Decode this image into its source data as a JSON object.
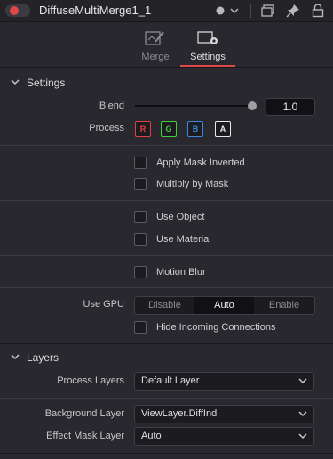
{
  "header": {
    "title": "DiffuseMultiMerge1_1",
    "icons": [
      "record-icon",
      "chevron-down-icon",
      "dot-icon",
      "chevron-down-icon",
      "window-icon",
      "pin-icon",
      "lock-icon"
    ]
  },
  "tabs": [
    {
      "label": "Merge",
      "icon": "merge-icon",
      "active": false
    },
    {
      "label": "Settings",
      "icon": "settings-icon",
      "active": true
    }
  ],
  "colors": {
    "accent": "#e04848",
    "r": "#e04040",
    "g": "#40d040",
    "b": "#3a86e0",
    "a": "#e8e8e8"
  },
  "settings": {
    "section_label": "Settings",
    "blend_label": "Blend",
    "blend_value": "1.0",
    "blend_fraction": 1.0,
    "process_label": "Process",
    "channels": [
      "R",
      "G",
      "B",
      "A"
    ],
    "apply_mask_inverted": "Apply Mask Inverted",
    "multiply_by_mask": "Multiply by Mask",
    "use_object": "Use Object",
    "use_material": "Use Material",
    "motion_blur": "Motion Blur",
    "use_gpu_label": "Use GPU",
    "gpu_options": [
      "Disable",
      "Auto",
      "Enable"
    ],
    "gpu_selected": "Auto",
    "hide_incoming": "Hide Incoming Connections"
  },
  "layers": {
    "section_label": "Layers",
    "process_layers_label": "Process Layers",
    "process_layers_value": "Default Layer",
    "background_layer_label": "Background Layer",
    "background_layer_value": "ViewLayer.DiffInd",
    "effect_mask_layer_label": "Effect Mask Layer",
    "effect_mask_layer_value": "Auto"
  }
}
